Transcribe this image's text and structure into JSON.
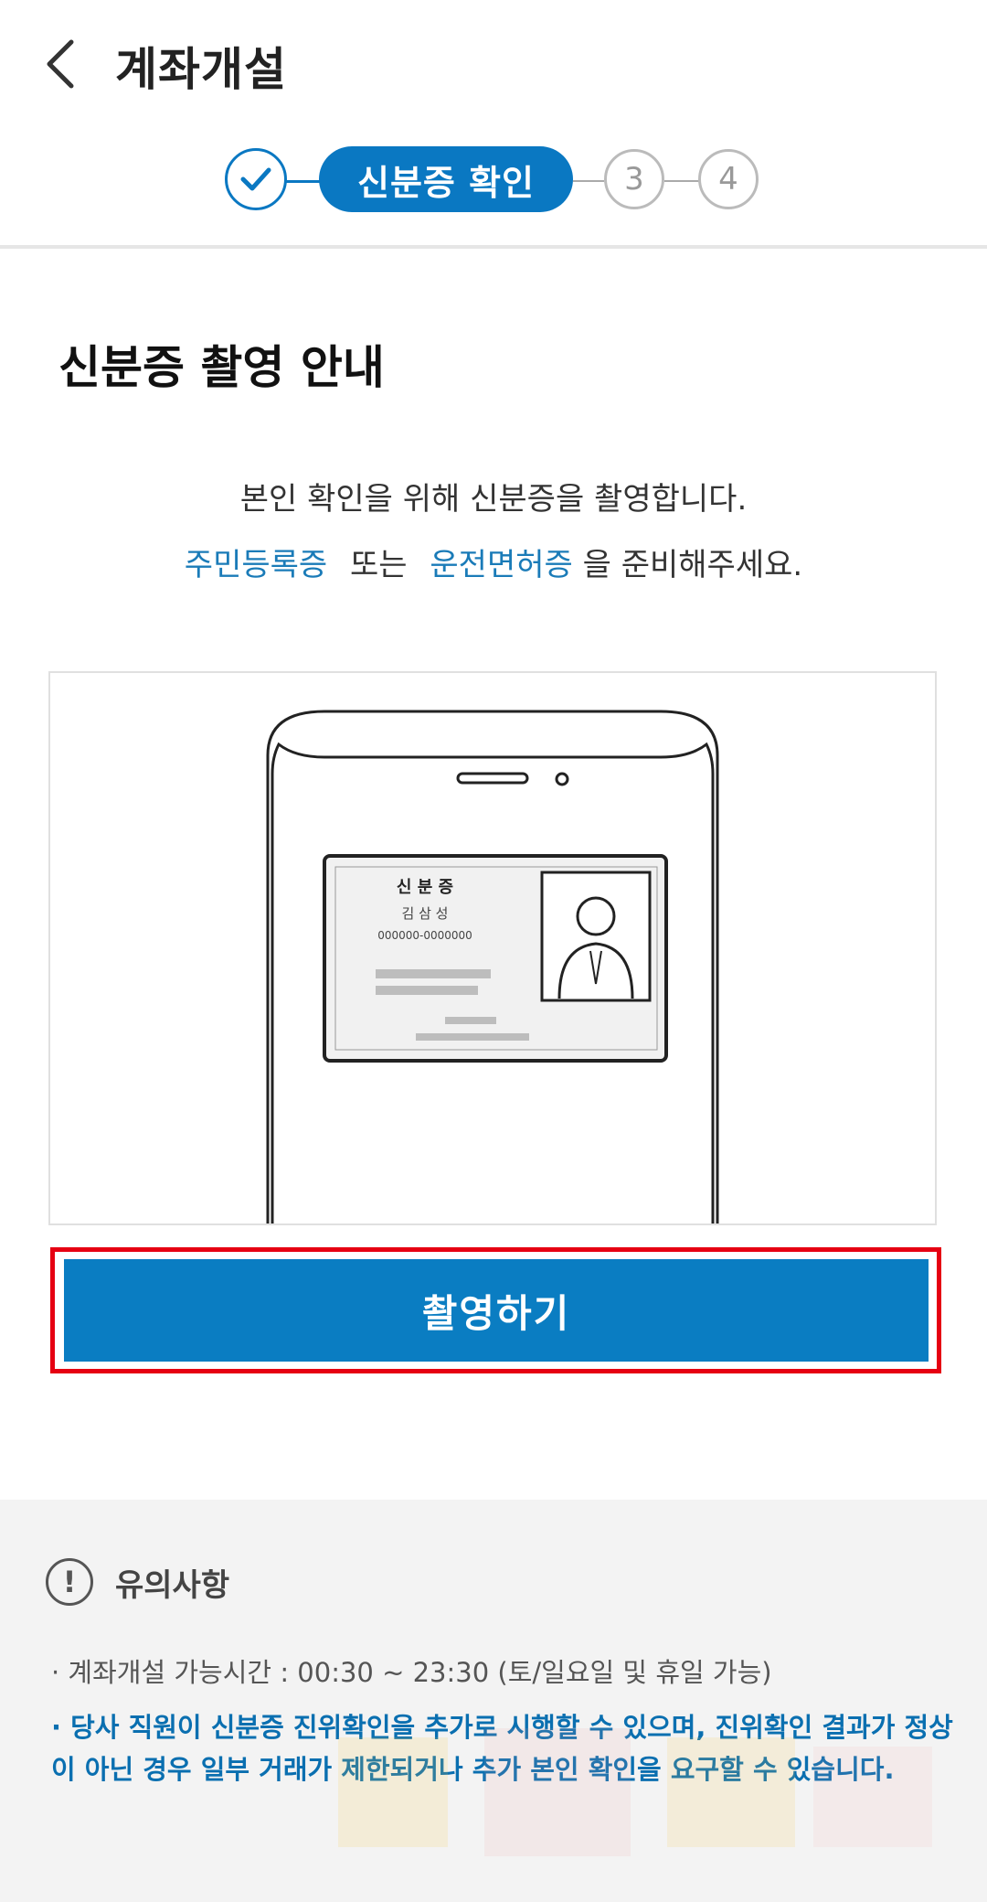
{
  "header": {
    "title": "계좌개설"
  },
  "stepper": {
    "active_label": "신분증 확인",
    "step3": "3",
    "step4": "4"
  },
  "main": {
    "section_title": "신분증 촬영 안내",
    "desc_line1": "본인 확인을 위해 신분증을 촬영합니다.",
    "desc_line2": {
      "highlight1": "주민등록증",
      "text1": "또는",
      "highlight2": "운전면허증",
      "text2": "을 준비해주세요."
    },
    "illustration": {
      "card_title": "신 분 증",
      "card_name": "김 삼 성",
      "card_number": "000000-0000000"
    },
    "cta_label": "촬영하기"
  },
  "notice": {
    "title": "유의사항",
    "icon_glyph": "!",
    "line1": "· 계좌개설 가능시간 : 00:30 ~ 23:30 (토/일요일 및 휴일 가능)",
    "line2": "· 당사 직원이 신분증 진위확인을 추가로 시행할 수 있으며, 진위확인 결과가 정상이 아닌 경우 일부 거래가 제한되거나 추가 본인 확인을 요구할 수 있습니다."
  },
  "colors": {
    "accent": "#0a78c2",
    "highlight_text": "#1a7bb8",
    "cta_frame": "#e60012"
  }
}
